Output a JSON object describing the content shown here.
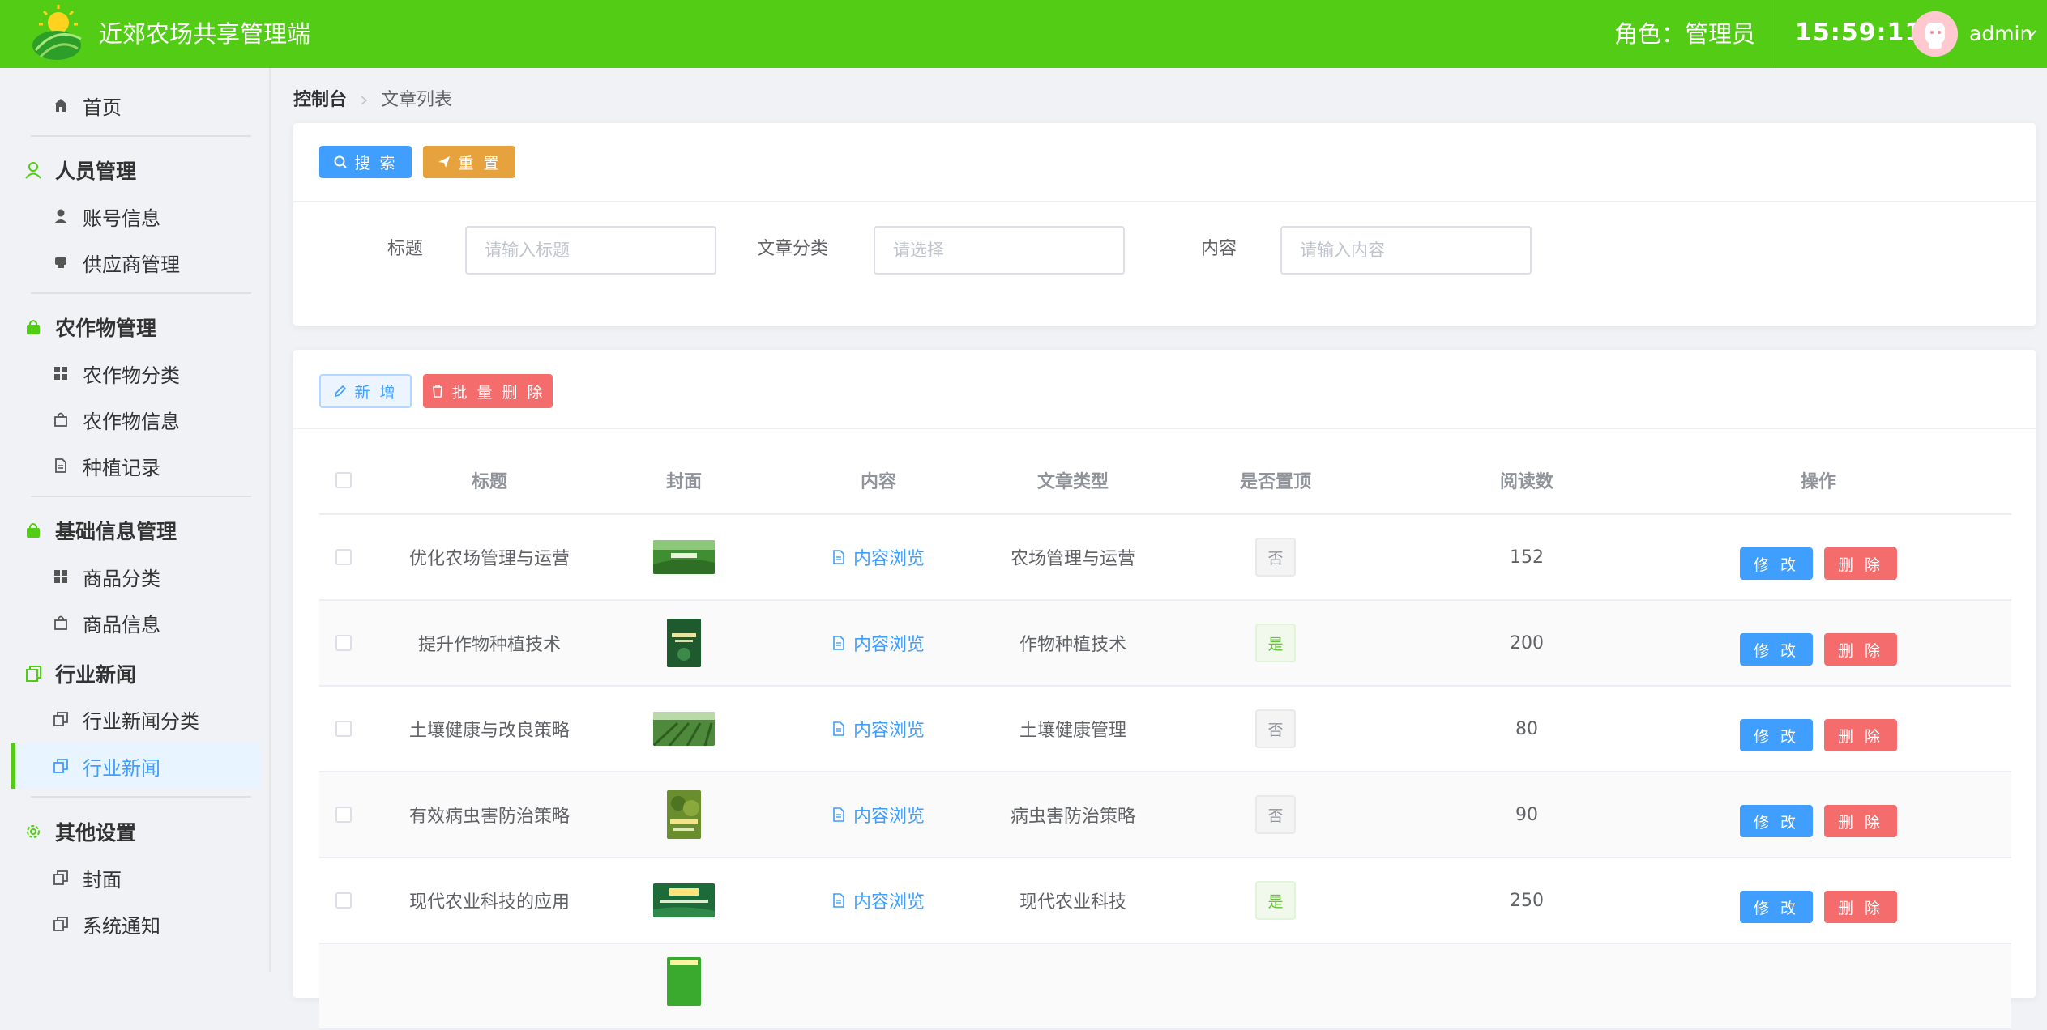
{
  "app": {
    "title": "近郊农场共享管理端"
  },
  "header": {
    "role_text": "角色：管理员",
    "clock": "15:59:11",
    "user": "admin"
  },
  "sidebar": {
    "home": "首页",
    "personnel": {
      "label": "人员管理",
      "items": [
        "账号信息",
        "供应商管理"
      ]
    },
    "crops": {
      "label": "农作物管理",
      "items": [
        "农作物分类",
        "农作物信息",
        "种植记录"
      ]
    },
    "basic": {
      "label": "基础信息管理",
      "items": [
        "商品分类",
        "商品信息"
      ]
    },
    "news": {
      "label": "行业新闻",
      "items": [
        "行业新闻分类",
        "行业新闻"
      ]
    },
    "other": {
      "label": "其他设置",
      "items": [
        "封面",
        "系统通知"
      ]
    }
  },
  "breadcrumb": {
    "home": "控制台",
    "current": "文章列表"
  },
  "search": {
    "search_label": "搜 索",
    "reset_label": "重 置",
    "title_label": "标题",
    "title_placeholder": "请输入标题",
    "category_label": "文章分类",
    "category_placeholder": "请选择",
    "content_label": "内容",
    "content_placeholder": "请输入内容"
  },
  "toolbar": {
    "add_label": "新 增",
    "batch_delete_label": "批 量 删 除"
  },
  "table": {
    "headers": [
      "标题",
      "封面",
      "内容",
      "文章类型",
      "是否置顶",
      "阅读数",
      "操作"
    ],
    "view_label": "内容浏览",
    "edit_label": "修 改",
    "delete_label": "删 除",
    "rows": [
      {
        "title": "优化农场管理与运营",
        "type": "农场管理与运营",
        "pinned": "否",
        "reads": "152"
      },
      {
        "title": "提升作物种植技术",
        "type": "作物种植技术",
        "pinned": "是",
        "reads": "200"
      },
      {
        "title": "土壤健康与改良策略",
        "type": "土壤健康管理",
        "pinned": "否",
        "reads": "80"
      },
      {
        "title": "有效病虫害防治策略",
        "type": "病虫害防治策略",
        "pinned": "否",
        "reads": "90"
      },
      {
        "title": "现代农业科技的应用",
        "type": "现代农业科技",
        "pinned": "是",
        "reads": "250"
      }
    ]
  },
  "colors": {
    "header_green": "#52cc14",
    "primary": "#409eff",
    "warning": "#e6a23c",
    "danger": "#f56c6c"
  }
}
